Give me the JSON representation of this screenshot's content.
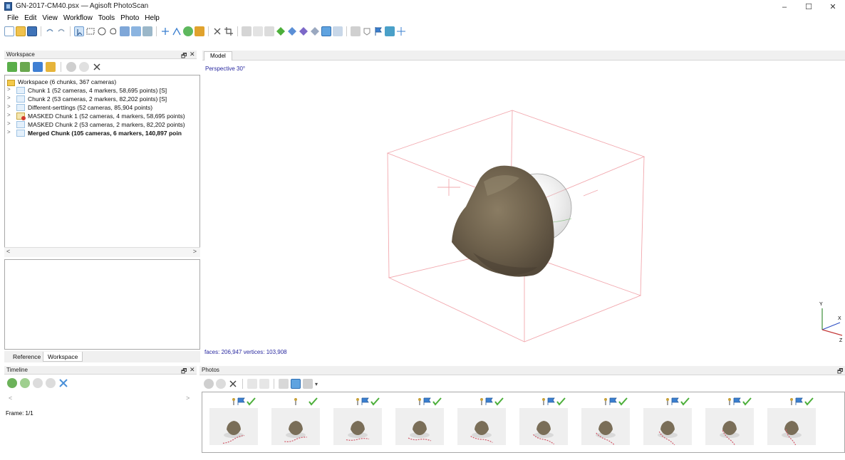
{
  "window": {
    "title": "GN-2017-CM40.psx — Agisoft PhotoScan",
    "minimize_glyph": "–",
    "maximize_glyph": "☐",
    "close_glyph": "✕"
  },
  "menu": [
    "File",
    "Edit",
    "View",
    "Workflow",
    "Tools",
    "Photo",
    "Help"
  ],
  "workspace": {
    "title": "Workspace",
    "root_label": "Workspace (6 chunks, 367 cameras)",
    "chunks": [
      {
        "label": "Chunk 1 (52 cameras, 4 markers, 58,695 points) [S]",
        "bold": false,
        "masked_icon": false
      },
      {
        "label": "Chunk 2 (53 cameras, 2 markers, 82,202 points) [S]",
        "bold": false,
        "masked_icon": false
      },
      {
        "label": "Different-serttings (52 cameras, 85,904 points)",
        "bold": false,
        "masked_icon": false
      },
      {
        "label": "MASKED Chunk 1 (52 cameras, 4 markers, 58,695 points)",
        "bold": false,
        "masked_icon": true
      },
      {
        "label": "MASKED Chunk 2 (53 cameras, 2 markers, 82,202 points)",
        "bold": false,
        "masked_icon": false
      },
      {
        "label": "Merged Chunk (105 cameras, 6 markers, 140,897 poin",
        "bold": true,
        "masked_icon": false
      }
    ],
    "tabs": [
      "Reference",
      "Workspace"
    ],
    "active_tab": "Workspace"
  },
  "timeline": {
    "title": "Timeline",
    "frame_label": "Frame: 1/1",
    "left_arrow": "<",
    "right_arrow": ">"
  },
  "model": {
    "tab_label": "Model",
    "perspective_label": "Perspective 30°",
    "stats_label": "faces: 206,947 vertices: 103,908",
    "axes": {
      "y": "Y",
      "x": "X",
      "z": "Z"
    }
  },
  "photos": {
    "title": "Photos",
    "count": 10
  },
  "colors": {
    "bbox": "#f2a8ae",
    "rock": "#7a6e58",
    "accent_blue": "#3a7fd0",
    "check_green": "#4caf3a"
  }
}
